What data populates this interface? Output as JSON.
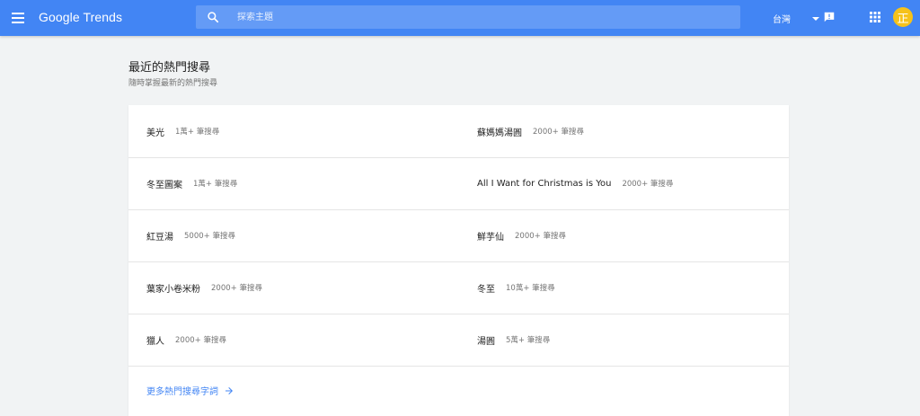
{
  "header": {
    "brand": "Google Trends",
    "search_placeholder": "探索主題",
    "region": "台灣",
    "avatar_letter": "正",
    "brand_color": "#4285f4",
    "avatar_color": "#f6c21a"
  },
  "section": {
    "title": "最近的熱門搜尋",
    "subtitle": "隨時掌握最新的熱門搜尋"
  },
  "trends": {
    "left": [
      {
        "term": "美光",
        "count": "1萬+ 筆搜尋"
      },
      {
        "term": "冬至圖案",
        "count": "1萬+ 筆搜尋"
      },
      {
        "term": "紅豆湯",
        "count": "5000+ 筆搜尋"
      },
      {
        "term": "葉家小卷米粉",
        "count": "2000+ 筆搜尋"
      },
      {
        "term": "獵人",
        "count": "2000+ 筆搜尋"
      }
    ],
    "right": [
      {
        "term": "蘇媽媽湯圓",
        "count": "2000+ 筆搜尋"
      },
      {
        "term": "All I Want for Christmas is You",
        "count": "2000+ 筆搜尋"
      },
      {
        "term": "鮮芋仙",
        "count": "2000+ 筆搜尋"
      },
      {
        "term": "冬至",
        "count": "10萬+ 筆搜尋"
      },
      {
        "term": "湯圓",
        "count": "5萬+ 筆搜尋"
      }
    ]
  },
  "more_link": "更多熱門搜尋字詞",
  "icons": {
    "menu": "menu-icon",
    "search": "search-icon",
    "caret": "caret-down-icon",
    "feedback": "feedback-icon",
    "apps": "apps-grid-icon",
    "arrow": "arrow-forward-icon"
  }
}
